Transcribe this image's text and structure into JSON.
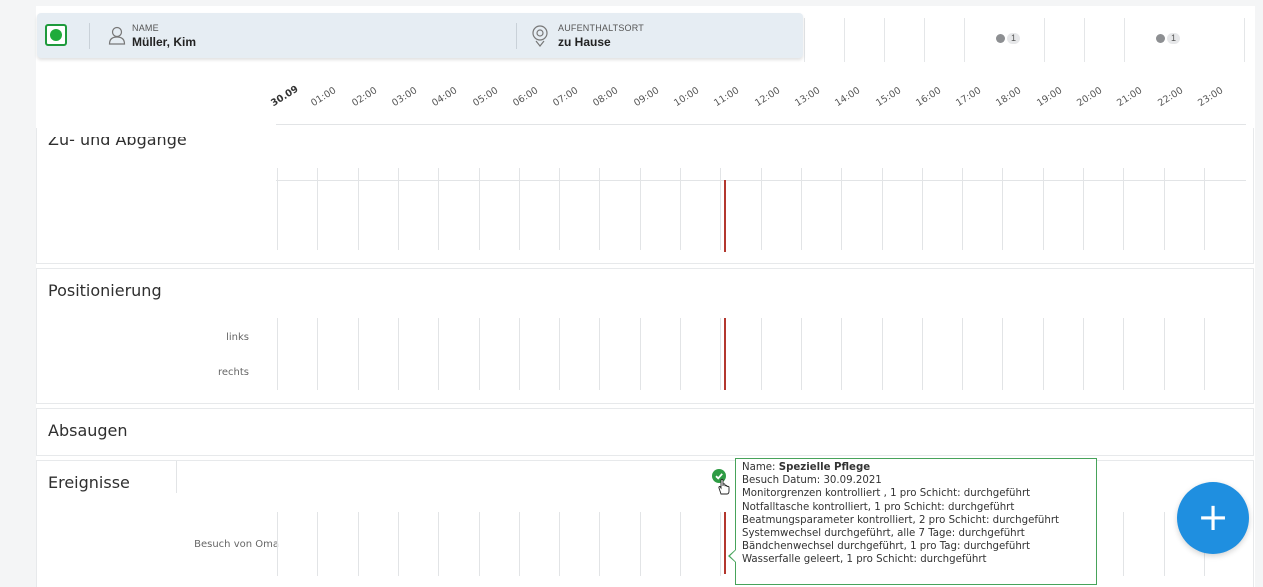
{
  "patient": {
    "status_color": "#1fab3a",
    "name_label": "NAME",
    "name_value": "Müller, Kim",
    "location_label": "AUFENTHALTSORT",
    "location_value": "zu Hause"
  },
  "top_badges": [
    {
      "count": "1"
    },
    {
      "count": "1"
    }
  ],
  "timeline": {
    "hours": [
      "30.09",
      "01:00",
      "02:00",
      "03:00",
      "04:00",
      "05:00",
      "06:00",
      "07:00",
      "08:00",
      "09:00",
      "10:00",
      "11:00",
      "12:00",
      "13:00",
      "14:00",
      "15:00",
      "16:00",
      "17:00",
      "18:00",
      "19:00",
      "20:00",
      "21:00",
      "22:00",
      "23:00"
    ],
    "current_hour_fraction": 11.1
  },
  "sections": {
    "zu_abgaenge": {
      "title": "Zu- und Abgänge"
    },
    "positionierung": {
      "title": "Positionierung",
      "rows": [
        "links",
        "rechts"
      ]
    },
    "absaugen": {
      "title": "Absaugen"
    },
    "ereignisse": {
      "title": "Ereignisse",
      "rows": [
        "Besuch von Oma"
      ]
    }
  },
  "tooltip": {
    "name_prefix": "Name: ",
    "name_value": "Spezielle Pflege",
    "lines": [
      "Besuch Datum: 30.09.2021",
      "Monitorgrenzen kontrolliert , 1 pro Schicht: durchgeführt",
      "Notfalltasche kontrolliert, 1 pro Schicht: durchgeführt",
      "Beatmungsparameter kontrolliert, 2 pro Schicht: durchgeführt",
      "Systemwechsel durchgeführt, alle 7 Tage: durchgeführt",
      "Bändchenwechsel durchgeführt, 1 pro Tag: durchgeführt",
      "Wasserfalle geleert, 1 pro Schicht: durchgeführt"
    ]
  },
  "colors": {
    "accent": "#1f8fe0",
    "now_line": "#b3372e",
    "event_ok": "#2e9c44"
  },
  "icons": {
    "add_button": "plus-icon",
    "name_field": "person-icon",
    "location_field": "location-pin-icon",
    "event": "check-circle-icon"
  }
}
